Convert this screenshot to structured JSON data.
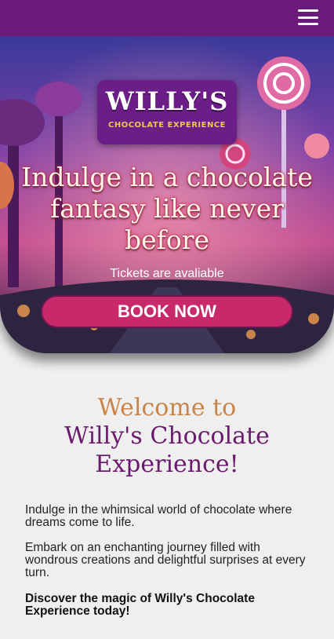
{
  "header": {
    "menu_icon": "hamburger-menu-icon",
    "background_color": "#6a1b7a"
  },
  "hero": {
    "logo_title": "WILLY'S",
    "logo_subtitle": "CHOCOLATE EXPERIENCE",
    "headline": "Indulge in a chocolate fantasy like never before",
    "subtext": "Tickets are avaliable",
    "button_label": "BOOK NOW",
    "button_color": "#c8296a"
  },
  "welcome": {
    "line1": "Welcome to",
    "line2": "Willy's Chocolate Experience!",
    "line1_color": "#c9844a",
    "line2_color": "#6a1b6e"
  },
  "body": {
    "paragraphs": [
      "Indulge in the whimsical world of chocolate where dreams come to life.",
      "Embark on an enchanting journey filled with wondrous creations and delightful surprises at every turn."
    ],
    "closing": "Discover the magic of Willy's Chocolate Experience today!"
  }
}
